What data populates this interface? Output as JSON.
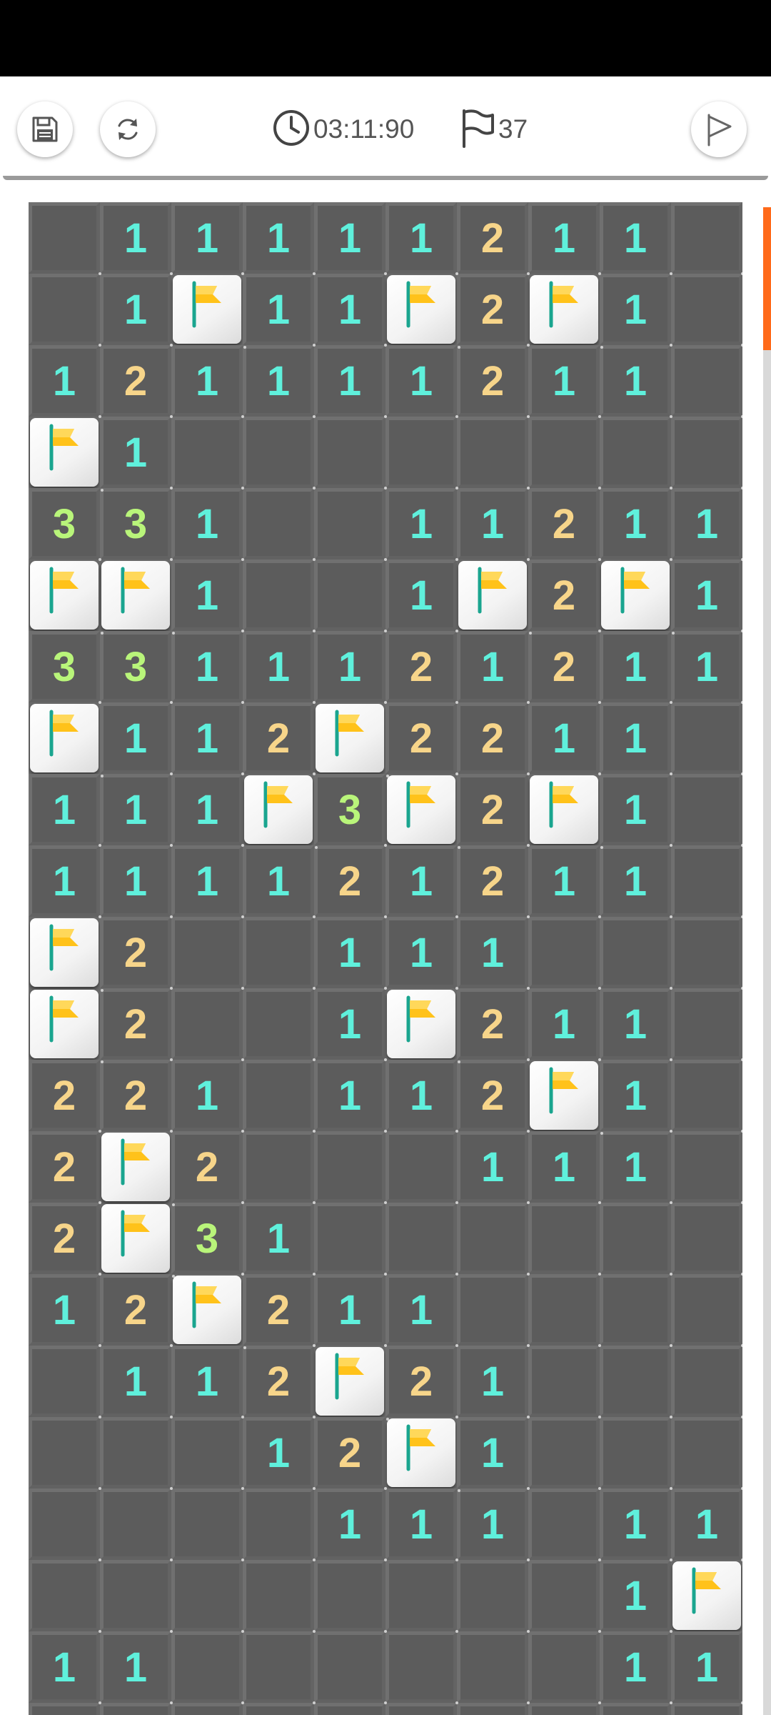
{
  "toolbar": {
    "save_icon": "save-icon",
    "refresh_icon": "refresh-icon",
    "clock_icon": "clock-icon",
    "timer": "03:11:90",
    "flag_icon": "flag-outline-icon",
    "flags": "37",
    "flag_mode_icon": "flag-mode-icon"
  },
  "board": {
    "columns": 10,
    "legend": "F = flagged cell, digit = revealed count, empty = revealed blank",
    "rows": [
      [
        "",
        "1",
        "1",
        "1",
        "1",
        "1",
        "2",
        "1",
        "1",
        ""
      ],
      [
        "",
        "1",
        "F",
        "1",
        "1",
        "F",
        "2",
        "F",
        "1",
        ""
      ],
      [
        "1",
        "2",
        "1",
        "1",
        "1",
        "1",
        "2",
        "1",
        "1",
        ""
      ],
      [
        "F",
        "1",
        "",
        "",
        "",
        "",
        "",
        "",
        "",
        ""
      ],
      [
        "3",
        "3",
        "1",
        "",
        "",
        "1",
        "1",
        "2",
        "1",
        "1"
      ],
      [
        "F",
        "F",
        "1",
        "",
        "",
        "1",
        "F",
        "2",
        "F",
        "1"
      ],
      [
        "3",
        "3",
        "1",
        "1",
        "1",
        "2",
        "1",
        "2",
        "1",
        "1"
      ],
      [
        "F",
        "1",
        "1",
        "2",
        "F",
        "2",
        "2",
        "1",
        "1",
        ""
      ],
      [
        "1",
        "1",
        "1",
        "F",
        "3",
        "F",
        "2",
        "F",
        "1",
        ""
      ],
      [
        "1",
        "1",
        "1",
        "1",
        "2",
        "1",
        "2",
        "1",
        "1",
        ""
      ],
      [
        "F",
        "2",
        "",
        "",
        "1",
        "1",
        "1",
        "",
        "",
        ""
      ],
      [
        "F",
        "2",
        "",
        "",
        "1",
        "F",
        "2",
        "1",
        "1",
        ""
      ],
      [
        "2",
        "2",
        "1",
        "",
        "1",
        "1",
        "2",
        "F",
        "1",
        ""
      ],
      [
        "2",
        "F",
        "2",
        "",
        "",
        "",
        "1",
        "1",
        "1",
        ""
      ],
      [
        "2",
        "F",
        "3",
        "1",
        "",
        "",
        "",
        "",
        "",
        ""
      ],
      [
        "1",
        "2",
        "F",
        "2",
        "1",
        "1",
        "",
        "",
        "",
        ""
      ],
      [
        "",
        "1",
        "1",
        "2",
        "F",
        "2",
        "1",
        "",
        "",
        ""
      ],
      [
        "",
        "",
        "",
        "1",
        "2",
        "F",
        "1",
        "",
        "",
        ""
      ],
      [
        "",
        "",
        "",
        "",
        "1",
        "1",
        "1",
        "",
        "1",
        "1"
      ],
      [
        "",
        "",
        "",
        "",
        "",
        "",
        "",
        "",
        "1",
        "F"
      ],
      [
        "1",
        "1",
        "",
        "",
        "",
        "",
        "",
        "",
        "1",
        "1"
      ],
      [
        "",
        "",
        "",
        "",
        "",
        "",
        "",
        "",
        "",
        ""
      ]
    ]
  },
  "colors": {
    "number_1": "#5ff0dc",
    "number_2": "#f7d58a",
    "number_3": "#b9f57a",
    "flag": "#ffc21a",
    "scroll_thumb": "#ff6a1a"
  }
}
